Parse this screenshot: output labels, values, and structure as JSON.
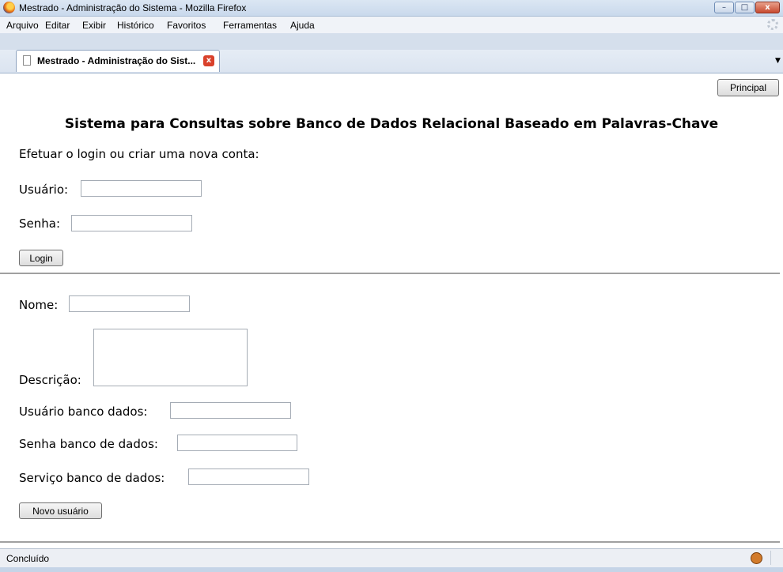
{
  "window": {
    "title": "Mestrado - Administração do Sistema - Mozilla Firefox",
    "controls": {
      "minimize": "–",
      "maximize": "□",
      "close": "x"
    }
  },
  "menubar": {
    "items": [
      "Arquivo",
      "Editar",
      "Exibir",
      "Histórico",
      "Favoritos",
      "Ferramentas",
      "Ajuda"
    ]
  },
  "tab": {
    "label": "Mestrado - Administração do Sist...",
    "close": "x"
  },
  "page": {
    "principal_button": "Principal",
    "heading": "Sistema para Consultas sobre Banco de Dados Relacional Baseado em Palavras-Chave",
    "login_prompt": "Efetuar o login ou criar uma nova conta:",
    "login": {
      "usuario_label": "Usuário:",
      "usuario_value": "",
      "senha_label": "Senha:",
      "senha_value": "",
      "button": "Login"
    },
    "register": {
      "nome_label": "Nome:",
      "descricao_label": "Descrição:",
      "usuario_bd_label": "Usuário banco dados:",
      "senha_bd_label": "Senha banco de dados:",
      "servico_bd_label": "Serviço banco de dados:",
      "button": "Novo usuário"
    }
  },
  "statusbar": {
    "text": "Concluído"
  },
  "icons": {
    "app": "firefox-icon",
    "page": "document-icon",
    "throbber": "throbber-icon",
    "status": "extension-icon"
  }
}
